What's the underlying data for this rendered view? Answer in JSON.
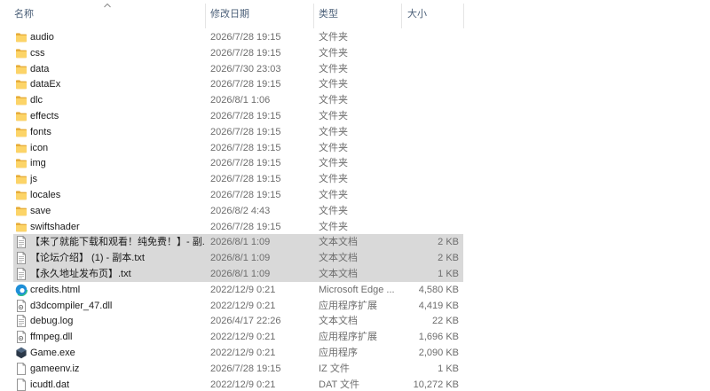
{
  "columns": {
    "name": "名称",
    "date": "修改日期",
    "type": "类型",
    "size": "大小"
  },
  "files": [
    {
      "name": "audio",
      "date": "2026/7/28 19:15",
      "type": "文件夹",
      "size": "",
      "icon": "folder-icon",
      "selected": false
    },
    {
      "name": "css",
      "date": "2026/7/28 19:15",
      "type": "文件夹",
      "size": "",
      "icon": "folder-icon",
      "selected": false
    },
    {
      "name": "data",
      "date": "2026/7/30 23:03",
      "type": "文件夹",
      "size": "",
      "icon": "folder-icon",
      "selected": false
    },
    {
      "name": "dataEx",
      "date": "2026/7/28 19:15",
      "type": "文件夹",
      "size": "",
      "icon": "folder-icon",
      "selected": false
    },
    {
      "name": "dlc",
      "date": "2026/8/1 1:06",
      "type": "文件夹",
      "size": "",
      "icon": "folder-icon",
      "selected": false
    },
    {
      "name": "effects",
      "date": "2026/7/28 19:15",
      "type": "文件夹",
      "size": "",
      "icon": "folder-icon",
      "selected": false
    },
    {
      "name": "fonts",
      "date": "2026/7/28 19:15",
      "type": "文件夹",
      "size": "",
      "icon": "folder-icon",
      "selected": false
    },
    {
      "name": "icon",
      "date": "2026/7/28 19:15",
      "type": "文件夹",
      "size": "",
      "icon": "folder-icon",
      "selected": false
    },
    {
      "name": "img",
      "date": "2026/7/28 19:15",
      "type": "文件夹",
      "size": "",
      "icon": "folder-icon",
      "selected": false
    },
    {
      "name": "js",
      "date": "2026/7/28 19:15",
      "type": "文件夹",
      "size": "",
      "icon": "folder-icon",
      "selected": false
    },
    {
      "name": "locales",
      "date": "2026/7/28 19:15",
      "type": "文件夹",
      "size": "",
      "icon": "folder-icon",
      "selected": false
    },
    {
      "name": "save",
      "date": "2026/8/2 4:43",
      "type": "文件夹",
      "size": "",
      "icon": "folder-icon",
      "selected": false
    },
    {
      "name": "swiftshader",
      "date": "2026/7/28 19:15",
      "type": "文件夹",
      "size": "",
      "icon": "folder-icon",
      "selected": false
    },
    {
      "name": "【来了就能下载和观看！纯免费！】- 副...",
      "date": "2026/8/1 1:09",
      "type": "文本文档",
      "size": "2 KB",
      "icon": "text-file-icon",
      "selected": true
    },
    {
      "name": "【论坛介绍】 (1) - 副本.txt",
      "date": "2026/8/1 1:09",
      "type": "文本文档",
      "size": "2 KB",
      "icon": "text-file-icon",
      "selected": true
    },
    {
      "name": "【永久地址发布页】.txt",
      "date": "2026/8/1 1:09",
      "type": "文本文档",
      "size": "1 KB",
      "icon": "text-file-icon",
      "selected": true
    },
    {
      "name": "credits.html",
      "date": "2022/12/9 0:21",
      "type": "Microsoft Edge ...",
      "size": "4,580 KB",
      "icon": "edge-html-icon",
      "selected": false
    },
    {
      "name": "d3dcompiler_47.dll",
      "date": "2022/12/9 0:21",
      "type": "应用程序扩展",
      "size": "4,419 KB",
      "icon": "dll-file-icon",
      "selected": false
    },
    {
      "name": "debug.log",
      "date": "2026/4/17 22:26",
      "type": "文本文档",
      "size": "22 KB",
      "icon": "text-file-icon",
      "selected": false
    },
    {
      "name": "ffmpeg.dll",
      "date": "2022/12/9 0:21",
      "type": "应用程序扩展",
      "size": "1,696 KB",
      "icon": "dll-file-icon",
      "selected": false
    },
    {
      "name": "Game.exe",
      "date": "2022/12/9 0:21",
      "type": "应用程序",
      "size": "2,090 KB",
      "icon": "game-exe-icon",
      "selected": false
    },
    {
      "name": "gameenv.iz",
      "date": "2026/7/28 19:15",
      "type": "IZ 文件",
      "size": "1 KB",
      "icon": "blank-file-icon",
      "selected": false
    },
    {
      "name": "icudtl.dat",
      "date": "2022/12/9 0:21",
      "type": "DAT 文件",
      "size": "10,272 KB",
      "icon": "blank-file-icon",
      "selected": false
    }
  ]
}
